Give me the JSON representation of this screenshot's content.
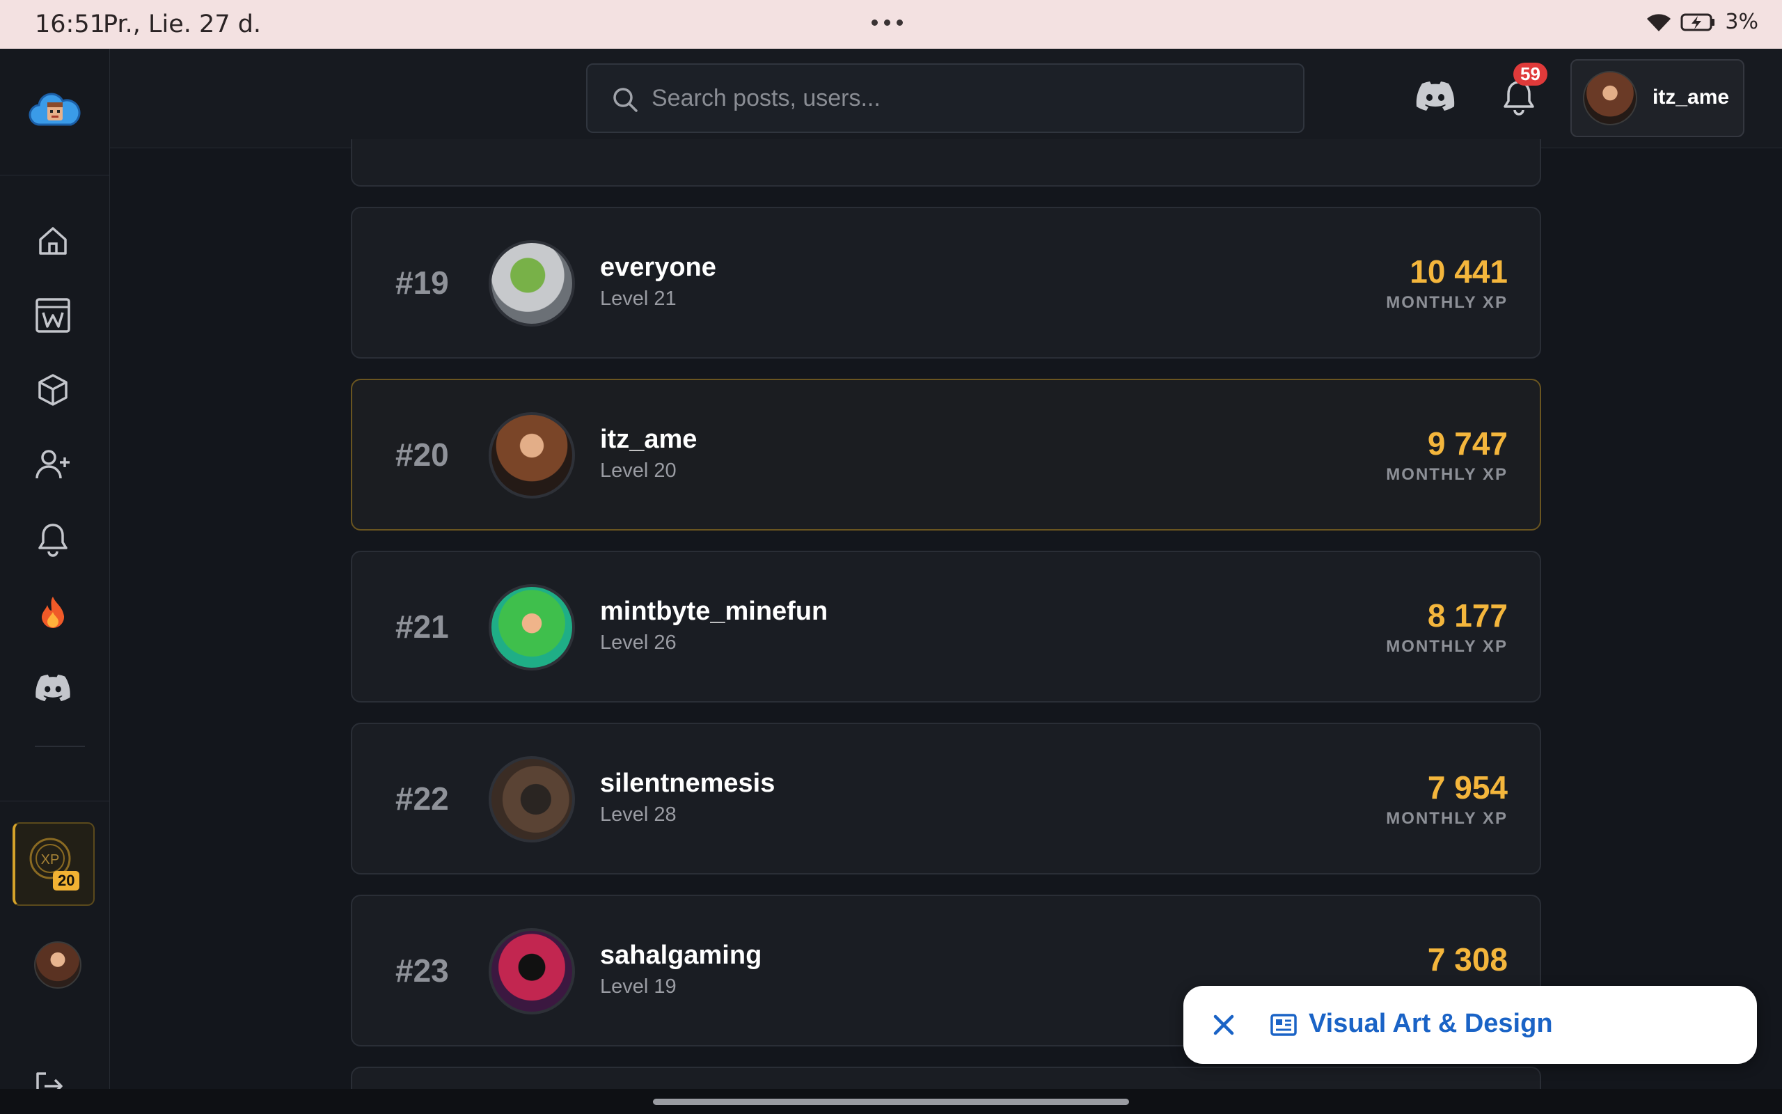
{
  "status_bar": {
    "time": "16:51",
    "date": "Pr., Lie. 27 d.",
    "battery": "3%"
  },
  "header": {
    "search_placeholder": "Search posts, users...",
    "notification_count": "59",
    "username": "itz_ame"
  },
  "sidebar": {
    "items": [
      {
        "icon": "home-icon"
      },
      {
        "icon": "wiki-icon"
      },
      {
        "icon": "cube-icon"
      },
      {
        "icon": "add-user-icon"
      },
      {
        "icon": "bell-icon"
      },
      {
        "icon": "fire-icon"
      },
      {
        "icon": "discord-icon"
      }
    ],
    "xp_level": "20",
    "xp_label": "XP"
  },
  "leaderboard": {
    "xp_label": "MONTHLY XP",
    "rows": [
      {
        "rank": "#19",
        "name": "everyone",
        "level": "Level 21",
        "xp": "10 441"
      },
      {
        "rank": "#20",
        "name": "itz_ame",
        "level": "Level 20",
        "xp": "9 747"
      },
      {
        "rank": "#21",
        "name": "mintbyte_minefun",
        "level": "Level 26",
        "xp": "8 177"
      },
      {
        "rank": "#22",
        "name": "silentnemesis",
        "level": "Level 28",
        "xp": "7 954"
      },
      {
        "rank": "#23",
        "name": "sahalgaming",
        "level": "Level 19",
        "xp": "7 308"
      }
    ]
  },
  "topic_chip": {
    "label": "Visual Art & Design"
  },
  "colors": {
    "accent_gold": "#f4b63c",
    "link_blue": "#1a63c6",
    "badge_red": "#e03a3a"
  }
}
